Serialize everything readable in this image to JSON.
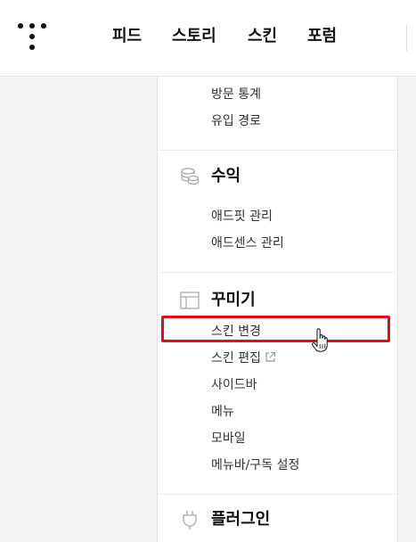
{
  "header": {
    "nav": [
      "피드",
      "스토리",
      "스킨",
      "포럼"
    ]
  },
  "menu": {
    "stats_items": [
      "방문 통계",
      "유입 경로"
    ],
    "revenue": {
      "title": "수익",
      "icon": "coins-icon",
      "items": [
        "애드핏 관리",
        "애드센스 관리"
      ]
    },
    "decorate": {
      "title": "꾸미기",
      "icon": "layout-icon",
      "items": [
        "스킨 변경",
        "스킨 편집",
        "사이드바",
        "메뉴",
        "모바일",
        "메뉴바/구독 설정"
      ]
    },
    "plugin": {
      "title": "플러그인",
      "icon": "plug-icon"
    }
  },
  "colors": {
    "highlight": "#e01010",
    "sidebar_bg": "#f5f5f7"
  }
}
